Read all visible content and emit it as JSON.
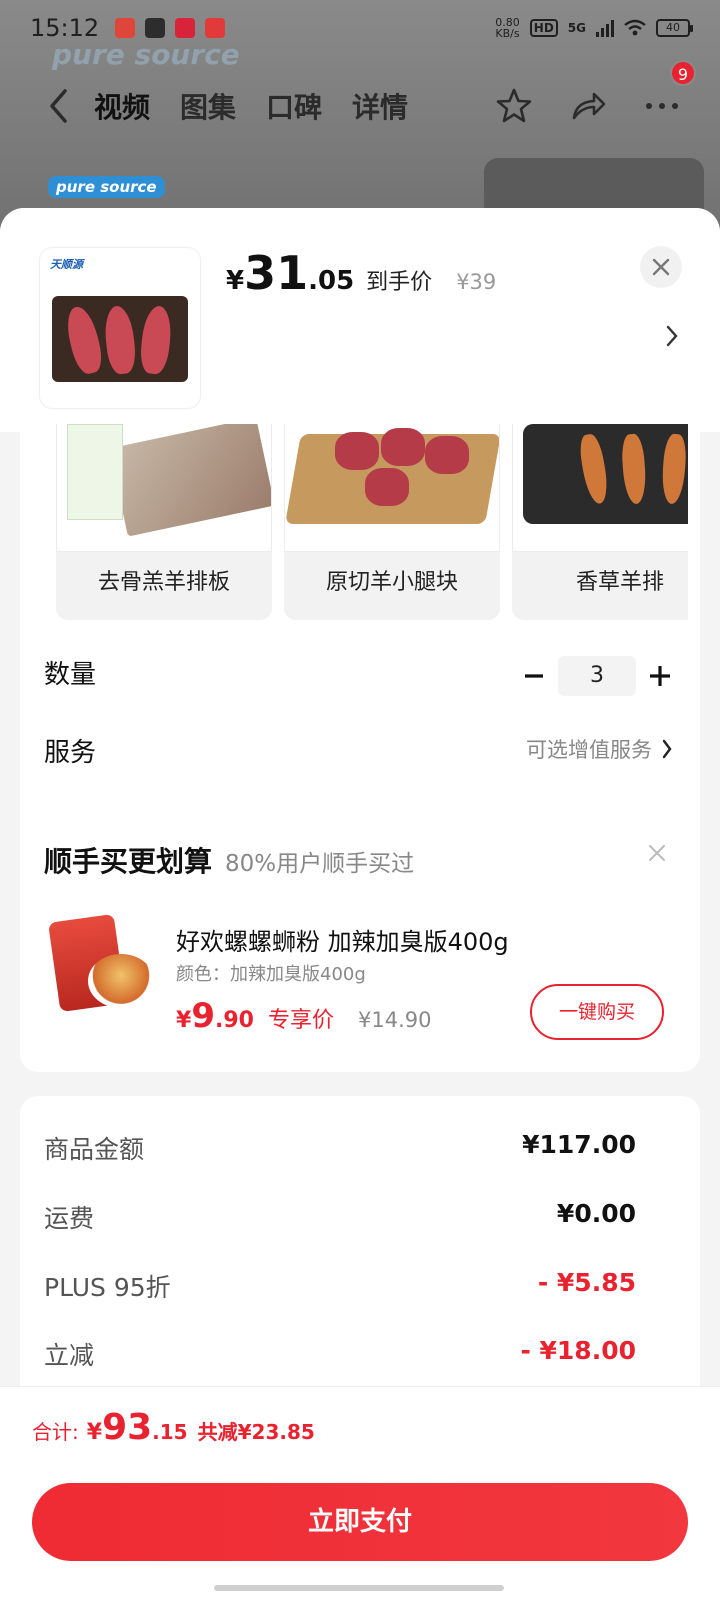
{
  "status_bar": {
    "time": "15:12",
    "net_speed_value": "0.80",
    "net_speed_unit": "KB/s",
    "hd": "HD",
    "network": "5G",
    "battery": "40"
  },
  "top_nav": {
    "tabs": [
      {
        "label": "视频"
      },
      {
        "label": "图集"
      },
      {
        "label": "口碑"
      },
      {
        "label": "详情"
      }
    ],
    "badge_count": "9"
  },
  "product": {
    "price_symbol": "¥",
    "price_int": "31",
    "price_dec": ".05",
    "price_tag": "到手价",
    "original_price": "¥39",
    "image_brand": "天顺源"
  },
  "variants": [
    {
      "label": "去骨羔羊排板"
    },
    {
      "label": "原切羊小腿块"
    },
    {
      "label": "香草羊排"
    }
  ],
  "quantity": {
    "label": "数量",
    "value": "3"
  },
  "service": {
    "label": "服务",
    "value": "可选增值服务"
  },
  "bundle": {
    "title": "顺手买更划算",
    "subtitle": "80%用户顺手买过",
    "item_name": "好欢螺螺蛳粉 加辣加臭版400g",
    "item_spec": "颜色：加辣加臭版400g",
    "price_symbol": "¥",
    "price_int": "9",
    "price_dec": ".90",
    "price_tag": "专享价",
    "original_price": "¥14.90",
    "buy_label": "一键购买"
  },
  "summary": {
    "rows": [
      {
        "label": "商品金额",
        "value": "¥117.00"
      },
      {
        "label": "运费",
        "value": "¥0.00"
      },
      {
        "label": "PLUS 95折",
        "value": "- ¥5.85"
      },
      {
        "label": "立减",
        "value": "- ¥18.00"
      }
    ]
  },
  "footer": {
    "total_label": "合计:",
    "total_symbol": "¥",
    "total_int": "93",
    "total_dec": ".15",
    "savings": "共减¥23.85",
    "pay_label": "立即支付"
  },
  "colors": {
    "accent": "#e8232f",
    "sheet_background": "#f4f4f4"
  }
}
